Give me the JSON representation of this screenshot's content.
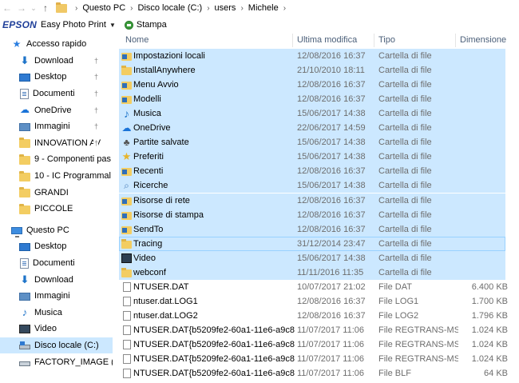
{
  "address_bar": {
    "back_icon": "back-arrow-icon",
    "forward_icon": "forward-arrow-icon",
    "recent_icon": "chevron-down-icon",
    "up_icon": "up-arrow-icon",
    "breadcrumbs": [
      "Questo PC",
      "Disco locale (C:)",
      "users",
      "Michele"
    ]
  },
  "toolbar": {
    "brand": "EPSON",
    "app_label": "Easy Photo Print",
    "print_label": "Stampa"
  },
  "sidebar": {
    "quick_access_label": "Accesso rapido",
    "quick_items": [
      {
        "label": "Download",
        "icon": "download-icon",
        "pinned": true
      },
      {
        "label": "Desktop",
        "icon": "desktop-icon",
        "pinned": true
      },
      {
        "label": "Documenti",
        "icon": "documents-icon",
        "pinned": true
      },
      {
        "label": "OneDrive",
        "icon": "onedrive-icon",
        "pinned": true
      },
      {
        "label": "Immagini",
        "icon": "pictures-icon",
        "pinned": true
      },
      {
        "label": "INNOVATION AV",
        "icon": "folder-icon",
        "pinned": true
      },
      {
        "label": "9 - Componenti pas",
        "icon": "folder-icon",
        "pinned": false
      },
      {
        "label": "10 - IC Programmal",
        "icon": "folder-icon",
        "pinned": false
      },
      {
        "label": "GRANDI",
        "icon": "folder-icon",
        "pinned": false
      },
      {
        "label": "PICCOLE",
        "icon": "folder-icon",
        "pinned": false
      }
    ],
    "this_pc_label": "Questo PC",
    "pc_items": [
      {
        "label": "Desktop",
        "icon": "desktop-icon"
      },
      {
        "label": "Documenti",
        "icon": "documents-icon"
      },
      {
        "label": "Download",
        "icon": "download-icon"
      },
      {
        "label": "Immagini",
        "icon": "pictures-icon"
      },
      {
        "label": "Musica",
        "icon": "music-icon"
      },
      {
        "label": "Video",
        "icon": "video-icon"
      },
      {
        "label": "Disco locale (C:)",
        "icon": "local-disk-icon",
        "selected": true
      },
      {
        "label": "FACTORY_IMAGE (D",
        "icon": "drive-icon"
      }
    ]
  },
  "columns": {
    "name": "Nome",
    "modified": "Ultima modifica",
    "type": "Tipo",
    "size": "Dimensione"
  },
  "files": [
    {
      "name": "Impostazioni locali",
      "modified": "12/08/2016 16:37",
      "type": "Cartella di file",
      "size": "",
      "icon": "system-folder-icon",
      "selected": true
    },
    {
      "name": "InstallAnywhere",
      "modified": "21/10/2010 18:11",
      "type": "Cartella di file",
      "size": "",
      "icon": "folder-icon",
      "selected": true
    },
    {
      "name": "Menu Avvio",
      "modified": "12/08/2016 16:37",
      "type": "Cartella di file",
      "size": "",
      "icon": "system-folder-icon",
      "selected": true
    },
    {
      "name": "Modelli",
      "modified": "12/08/2016 16:37",
      "type": "Cartella di file",
      "size": "",
      "icon": "system-folder-icon",
      "selected": true
    },
    {
      "name": "Musica",
      "modified": "15/06/2017 14:38",
      "type": "Cartella di file",
      "size": "",
      "icon": "music-icon",
      "selected": true
    },
    {
      "name": "OneDrive",
      "modified": "22/06/2017 14:59",
      "type": "Cartella di file",
      "size": "",
      "icon": "onedrive-icon",
      "selected": true
    },
    {
      "name": "Partite salvate",
      "modified": "15/06/2017 14:38",
      "type": "Cartella di file",
      "size": "",
      "icon": "saved-games-icon",
      "selected": true
    },
    {
      "name": "Preferiti",
      "modified": "15/06/2017 14:38",
      "type": "Cartella di file",
      "size": "",
      "icon": "favorites-star-icon",
      "selected": true
    },
    {
      "name": "Recenti",
      "modified": "12/08/2016 16:37",
      "type": "Cartella di file",
      "size": "",
      "icon": "system-folder-icon",
      "selected": true
    },
    {
      "name": "Ricerche",
      "modified": "15/06/2017 14:38",
      "type": "Cartella di file",
      "size": "",
      "icon": "search-icon",
      "selected": true
    },
    {
      "name": "Risorse di rete",
      "modified": "12/08/2016 16:37",
      "type": "Cartella di file",
      "size": "",
      "icon": "system-folder-icon",
      "selected": true
    },
    {
      "name": "Risorse di stampa",
      "modified": "12/08/2016 16:37",
      "type": "Cartella di file",
      "size": "",
      "icon": "system-folder-icon",
      "selected": true
    },
    {
      "name": "SendTo",
      "modified": "12/08/2016 16:37",
      "type": "Cartella di file",
      "size": "",
      "icon": "system-folder-icon",
      "selected": true
    },
    {
      "name": "Tracing",
      "modified": "31/12/2014 23:47",
      "type": "Cartella di file",
      "size": "",
      "icon": "folder-icon",
      "selected": true,
      "focused": true
    },
    {
      "name": "Video",
      "modified": "15/06/2017 14:38",
      "type": "Cartella di file",
      "size": "",
      "icon": "video-icon",
      "selected": true
    },
    {
      "name": "webconf",
      "modified": "11/11/2016 11:35",
      "type": "Cartella di file",
      "size": "",
      "icon": "folder-icon",
      "selected": true
    },
    {
      "name": "NTUSER.DAT",
      "modified": "10/07/2017 21:02",
      "type": "File DAT",
      "size": "6.400 KB",
      "icon": "file-icon",
      "selected": false
    },
    {
      "name": "ntuser.dat.LOG1",
      "modified": "12/08/2016 16:37",
      "type": "File LOG1",
      "size": "1.700 KB",
      "icon": "file-icon",
      "selected": false
    },
    {
      "name": "ntuser.dat.LOG2",
      "modified": "12/08/2016 16:37",
      "type": "File LOG2",
      "size": "1.796 KB",
      "icon": "file-icon",
      "selected": false
    },
    {
      "name": "NTUSER.DAT{b5209fe2-60a1-11e6-a9c8-...",
      "modified": "11/07/2017 11:06",
      "type": "File REGTRANS-MS",
      "size": "1.024 KB",
      "icon": "file-icon",
      "selected": false
    },
    {
      "name": "NTUSER.DAT{b5209fe2-60a1-11e6-a9c8-...",
      "modified": "11/07/2017 11:06",
      "type": "File REGTRANS-MS",
      "size": "1.024 KB",
      "icon": "file-icon",
      "selected": false
    },
    {
      "name": "NTUSER.DAT{b5209fe2-60a1-11e6-a9c8-...",
      "modified": "11/07/2017 11:06",
      "type": "File REGTRANS-MS",
      "size": "1.024 KB",
      "icon": "file-icon",
      "selected": false
    },
    {
      "name": "NTUSER.DAT{b5209fe2-60a1-11e6-a9c8-...",
      "modified": "11/07/2017 11:06",
      "type": "File BLF",
      "size": "64 KB",
      "icon": "file-icon",
      "selected": false
    }
  ],
  "colors": {
    "selection": "#cce8ff",
    "focus_border": "#99d1ff",
    "header_text": "#4c607a",
    "secondary_text": "#6d6d6d",
    "epson_blue": "#1f3f99"
  }
}
